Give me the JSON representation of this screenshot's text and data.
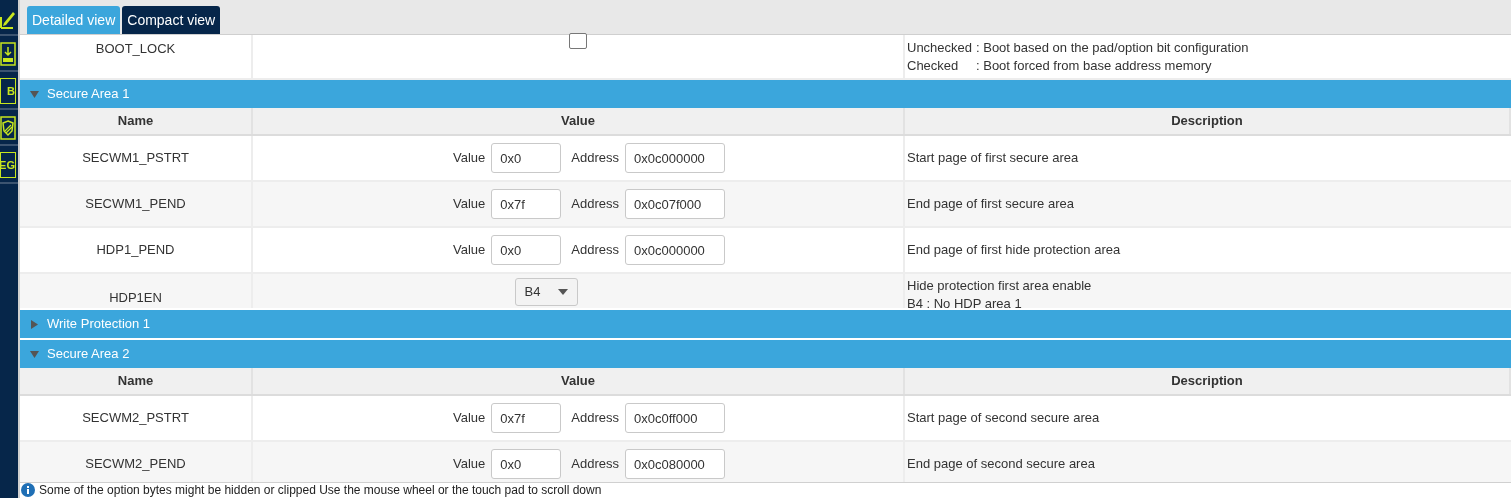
{
  "sidebar": {
    "items": [
      {
        "kind": "pencil"
      },
      {
        "kind": "download"
      },
      {
        "kind": "letters",
        "label": "B"
      },
      {
        "kind": "shield"
      },
      {
        "kind": "letters",
        "label": "EG"
      }
    ]
  },
  "tabs": [
    {
      "label": "Detailed view",
      "selected": true
    },
    {
      "label": "Compact view",
      "selected": false
    }
  ],
  "top_rows": [
    {
      "name": "BOOT_LOCK",
      "value": {
        "kind": "checkbox",
        "checked": false
      },
      "description": [
        {
          "term": "Unchecked",
          "text": ": Boot based on the pad/option bit configuration"
        },
        {
          "term": "Checked",
          "text": ": Boot forced from base address memory"
        }
      ]
    }
  ],
  "sections": [
    {
      "title": "Secure Area 1",
      "expanded": true,
      "columns": [
        "Name",
        "Value",
        "Description"
      ],
      "rows": [
        {
          "name": "SECWM1_PSTRT",
          "value": {
            "kind": "address",
            "value_label": "Value",
            "value": "0x0",
            "address_label": "Address",
            "address": "0x0c000000"
          },
          "description": [
            "Start page of first secure area"
          ]
        },
        {
          "name": "SECWM1_PEND",
          "value": {
            "kind": "address",
            "value_label": "Value",
            "value": "0x7f",
            "address_label": "Address",
            "address": "0x0c07f000"
          },
          "description": [
            "End page of first secure area"
          ]
        },
        {
          "name": "HDP1_PEND",
          "value": {
            "kind": "address",
            "value_label": "Value",
            "value": "0x0",
            "address_label": "Address",
            "address": "0x0c000000"
          },
          "description": [
            "End page of first hide protection area"
          ]
        },
        {
          "name": "HDP1EN",
          "value": {
            "kind": "dropdown",
            "value": "B4"
          },
          "description": [
            "Hide protection first area enable",
            "B4 : No HDP area 1"
          ]
        }
      ]
    },
    {
      "title": "Write Protection 1",
      "expanded": false
    },
    {
      "title": "Secure Area 2",
      "expanded": true,
      "columns": [
        "Name",
        "Value",
        "Description"
      ],
      "rows": [
        {
          "name": "SECWM2_PSTRT",
          "value": {
            "kind": "address",
            "value_label": "Value",
            "value": "0x7f",
            "address_label": "Address",
            "address": "0x0c0ff000"
          },
          "description": [
            "Start page of second secure area"
          ]
        },
        {
          "name": "SECWM2_PEND",
          "value": {
            "kind": "address",
            "value_label": "Value",
            "value": "0x0",
            "address_label": "Address",
            "address": "0x0c080000"
          },
          "description": [
            "End page of second secure area"
          ]
        }
      ]
    }
  ],
  "status_bar": {
    "text": "Some of the option bytes might be hidden or clipped Use the mouse wheel or the touch pad to scroll down"
  }
}
